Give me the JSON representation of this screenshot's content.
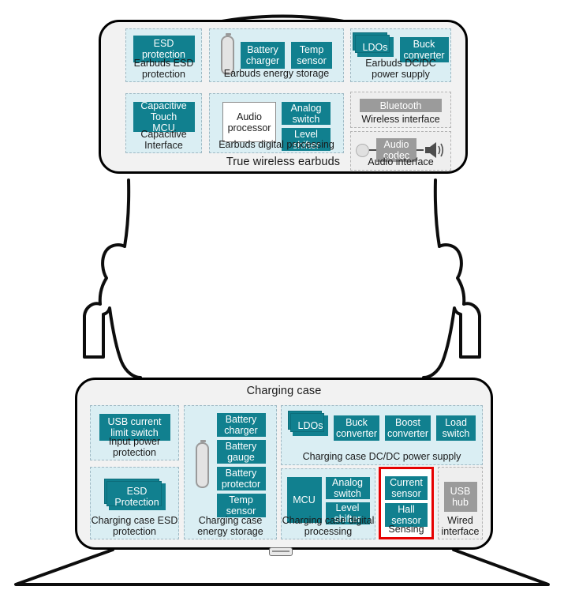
{
  "diagram": {
    "title_earbuds": "True wireless earbuds",
    "title_case": "Charging case"
  },
  "earbuds": {
    "groups": [
      {
        "id": "earbuds-esd",
        "label": "Earbuds ESD\nprotection",
        "chips": [
          {
            "text": "ESD\nprotection",
            "style": "teal"
          }
        ]
      },
      {
        "id": "earbuds-energy",
        "label": "Earbuds energy storage",
        "icon": "battery-icon",
        "chips": [
          {
            "text": "Battery\ncharger",
            "style": "teal"
          },
          {
            "text": "Temp\nsensor",
            "style": "teal"
          }
        ]
      },
      {
        "id": "earbuds-dcdc",
        "label": "Earbuds DC/DC power\nsupply",
        "chips": [
          {
            "text": "LDOs",
            "style": "teal-stacked"
          },
          {
            "text": "Buck\nconverter",
            "style": "teal"
          }
        ]
      },
      {
        "id": "earbuds-capacitive",
        "label": "Capacitive\nInterface",
        "chips": [
          {
            "text": "Capacitive\nTouch MCU",
            "style": "teal"
          }
        ]
      },
      {
        "id": "earbuds-digital",
        "label": "Earbuds digital processing",
        "chips": [
          {
            "text": "Audio\nprocessor",
            "style": "white"
          },
          {
            "text": "Analog\nswitch",
            "style": "teal"
          },
          {
            "text": "Level\nshifter",
            "style": "teal"
          }
        ]
      },
      {
        "id": "earbuds-wireless",
        "label": "Wireless interface",
        "chips": [
          {
            "text": "Bluetooth",
            "style": "grey"
          }
        ]
      },
      {
        "id": "earbuds-audio",
        "label": "Audio interface",
        "icons": [
          "microphone-icon",
          "speaker-icon"
        ],
        "chips": [
          {
            "text": "Audio\ncodec",
            "style": "grey"
          }
        ]
      }
    ]
  },
  "charging_case": {
    "groups": [
      {
        "id": "case-input-power",
        "label": "Input power\nprotection",
        "chips": [
          {
            "text": "USB current\nlimit switch",
            "style": "teal"
          }
        ]
      },
      {
        "id": "case-esd",
        "label": "Charging case\nESD protection",
        "chips": [
          {
            "text": "ESD\nProtection",
            "style": "teal-stacked"
          }
        ]
      },
      {
        "id": "case-energy",
        "label": "Charging case\nenergy storage",
        "icon": "battery-icon",
        "chips": [
          {
            "text": "Battery\ncharger",
            "style": "teal"
          },
          {
            "text": "Battery\ngauge",
            "style": "teal"
          },
          {
            "text": "Battery\nprotector",
            "style": "teal"
          },
          {
            "text": "Temp\nsensor",
            "style": "teal"
          }
        ]
      },
      {
        "id": "case-dcdc",
        "label": "Charging case DC/DC power supply",
        "chips": [
          {
            "text": "LDOs",
            "style": "teal-stacked"
          },
          {
            "text": "Buck\nconverter",
            "style": "teal"
          },
          {
            "text": "Boost\nconverter",
            "style": "teal"
          },
          {
            "text": "Load\nswitch",
            "style": "teal"
          }
        ]
      },
      {
        "id": "case-digital",
        "label": "Charging case digital\nprocessing",
        "chips": [
          {
            "text": "MCU",
            "style": "teal"
          },
          {
            "text": "Analog\nswitch",
            "style": "teal"
          },
          {
            "text": "Level\nshifter",
            "style": "teal"
          }
        ]
      },
      {
        "id": "case-sensing",
        "label": "Sensing",
        "highlighted": true,
        "chips": [
          {
            "text": "Current\nsensor",
            "style": "teal"
          },
          {
            "text": "Hall\nsensor",
            "style": "teal"
          }
        ]
      },
      {
        "id": "case-wired",
        "label": "Wired\ninterface",
        "chips": [
          {
            "text": "USB\nhub",
            "style": "grey"
          }
        ]
      }
    ]
  },
  "colors": {
    "chip_teal": "#11808f",
    "chip_grey": "#9b9b9b",
    "group_bg": "#daeef3",
    "group_bg_grey": "#eeeeee",
    "panel_bg": "#f2f2f2",
    "highlight": "#e60000",
    "outline": "#000000"
  }
}
